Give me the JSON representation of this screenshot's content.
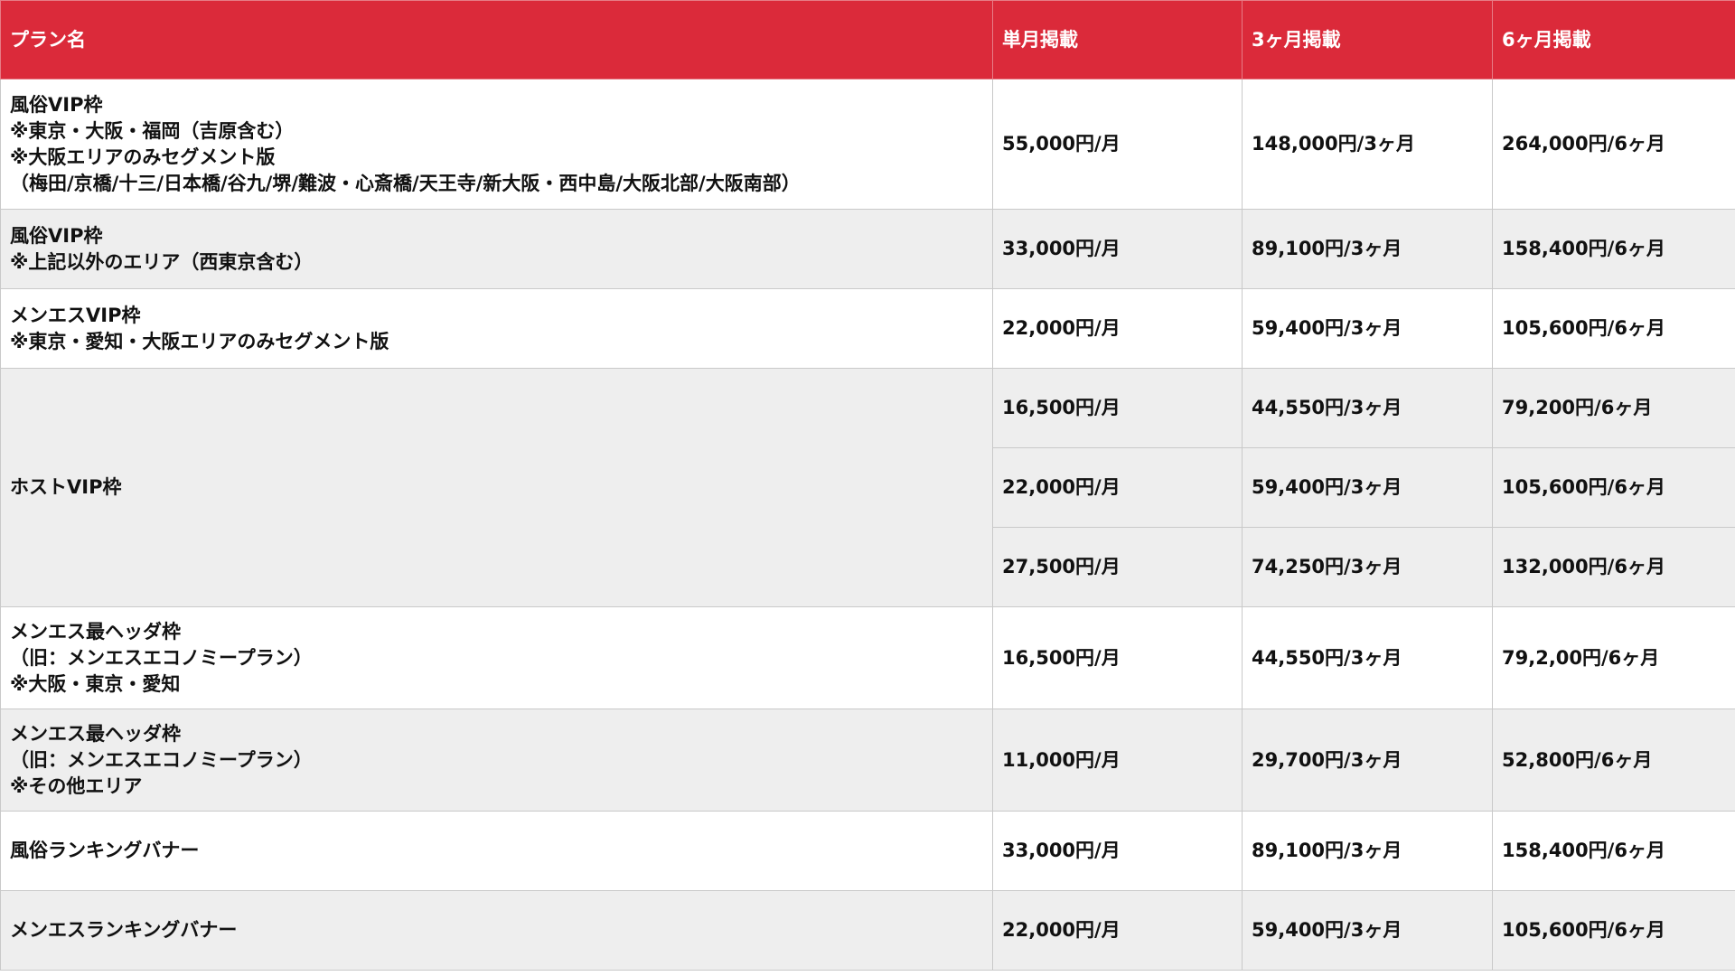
{
  "table": {
    "headers": {
      "plan": "プラン名",
      "one_month": "単月掲載",
      "three_months": "3ヶ月掲載",
      "six_months": "6ヶ月掲載"
    },
    "colors": {
      "header_bg": "#db2a3a",
      "header_text": "#ffffff",
      "row_alt_bg": "#eeeeee",
      "row_bg": "#ffffff"
    },
    "rows": [
      {
        "plan_lines": [
          "風俗VIP枠",
          "※東京・大阪・福岡（吉原含む）",
          "※大阪エリアのみセグメント版",
          "（梅田/京橋/十三/日本橋/谷九/堺/難波・心斎橋/天王寺/新大阪・西中島/大阪北部/大阪南部）"
        ],
        "one_month": "55,000円/月",
        "three_months": "148,000円/3ヶ月",
        "six_months": "264,000円/6ヶ月"
      },
      {
        "plan_lines": [
          "風俗VIP枠",
          "※上記以外のエリア（西東京含む）"
        ],
        "one_month": "33,000円/月",
        "three_months": "89,100円/3ヶ月",
        "six_months": "158,400円/6ヶ月"
      },
      {
        "plan_lines": [
          "メンエスVIP枠",
          "※東京・愛知・大阪エリアのみセグメント版"
        ],
        "one_month": "22,000円/月",
        "three_months": "59,400円/3ヶ月",
        "six_months": "105,600円/6ヶ月"
      },
      {
        "plan_lines": [
          "ホストVIP枠"
        ],
        "tiers": [
          {
            "one_month": "16,500円/月",
            "three_months": "44,550円/3ヶ月",
            "six_months": "79,200円/6ヶ月"
          },
          {
            "one_month": "22,000円/月",
            "three_months": "59,400円/3ヶ月",
            "six_months": "105,600円/6ヶ月"
          },
          {
            "one_month": "27,500円/月",
            "three_months": "74,250円/3ヶ月",
            "six_months": "132,000円/6ヶ月"
          }
        ]
      },
      {
        "plan_lines": [
          "メンエス最ヘッダ枠",
          "（旧：メンエスエコノミープラン）",
          "※大阪・東京・愛知"
        ],
        "one_month": "16,500円/月",
        "three_months": "44,550円/3ヶ月",
        "six_months": "79,2,00円/6ヶ月"
      },
      {
        "plan_lines": [
          "メンエス最ヘッダ枠",
          "（旧：メンエスエコノミープラン）",
          "※その他エリア"
        ],
        "one_month": "11,000円/月",
        "three_months": "29,700円/3ヶ月",
        "six_months": "52,800円/6ヶ月"
      },
      {
        "plan_lines": [
          "風俗ランキングバナー"
        ],
        "one_month": "33,000円/月",
        "three_months": "89,100円/3ヶ月",
        "six_months": "158,400円/6ヶ月"
      },
      {
        "plan_lines": [
          "メンエスランキングバナー"
        ],
        "one_month": "22,000円/月",
        "three_months": "59,400円/3ヶ月",
        "six_months": "105,600円/6ヶ月"
      }
    ]
  }
}
